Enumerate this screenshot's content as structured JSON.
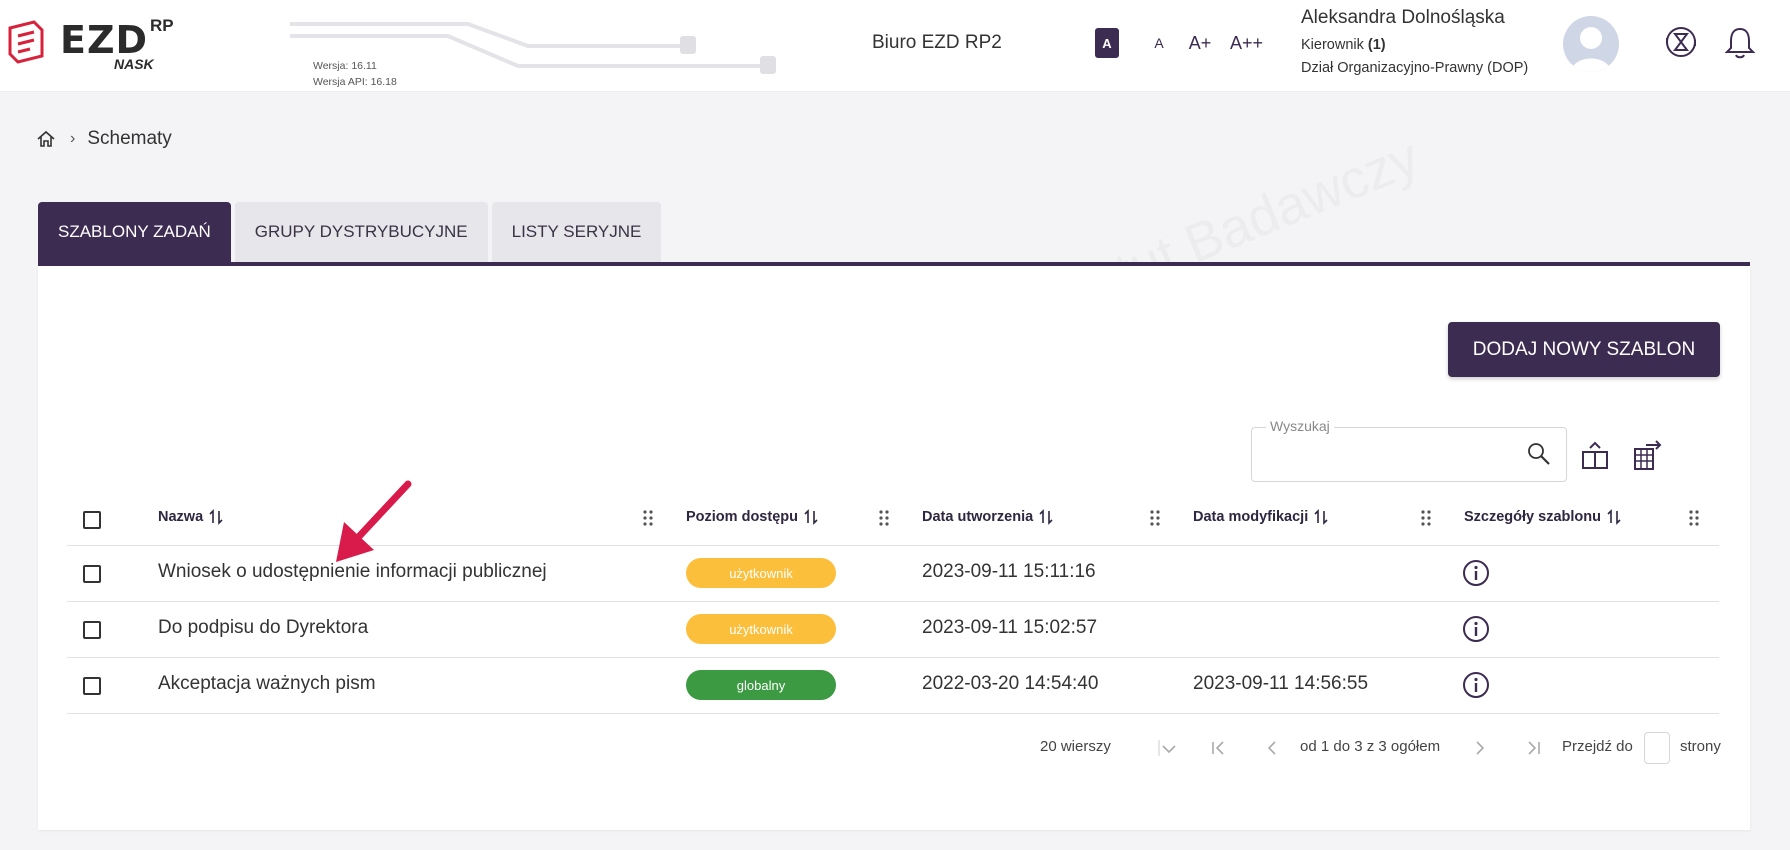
{
  "header": {
    "logo_main": "EZD",
    "logo_sup": "RP",
    "logo_sub": "NASK",
    "version": "Wersja: 16.11",
    "api_version": "Wersja API: 16.18",
    "office": "Biuro EZD RP2",
    "font_sizes": [
      "A",
      "A",
      "A+",
      "A++"
    ],
    "user": {
      "name": "Aleksandra Dolnośląska",
      "role": "Kierownik",
      "role_count": "(1)",
      "department": "Dział Organizacyjno-Prawny (DOP)"
    }
  },
  "breadcrumb": {
    "current": "Schematy"
  },
  "tabs": [
    {
      "label": "SZABLONY ZADAŃ",
      "active": true
    },
    {
      "label": "GRUPY DYSTRYBUCYJNE",
      "active": false
    },
    {
      "label": "LISTY SERYJNE",
      "active": false
    }
  ],
  "toolbar": {
    "add_label": "DODAJ NOWY SZABLON",
    "search_label": "Wyszukaj",
    "search_value": ""
  },
  "table": {
    "columns": [
      "Nazwa",
      "Poziom dostępu",
      "Data utworzenia",
      "Data modyfikacji",
      "Szczegóły szablonu"
    ],
    "rows": [
      {
        "name": "Wniosek o udostępnienie informacji publicznej",
        "access": "użytkownik",
        "created": "2023-09-11 15:11:16",
        "modified": ""
      },
      {
        "name": "Do podpisu do Dyrektora",
        "access": "użytkownik",
        "created": "2023-09-11 15:02:57",
        "modified": ""
      },
      {
        "name": "Akceptacja ważnych pism",
        "access": "globalny",
        "created": "2022-03-20 14:54:40",
        "modified": "2023-09-11 14:56:55"
      }
    ]
  },
  "pagination": {
    "rows_per_page": "20 wierszy",
    "range": "od 1 do 3 z 3 ogółem",
    "goto_label": "Przejdź do",
    "page_suffix": "strony",
    "page_value": ""
  },
  "colors": {
    "primary": "#3d2c52",
    "badge_user": "#fbbf3c",
    "badge_global": "#3c9a42",
    "annotation_arrow": "#d81b4a"
  },
  "watermark_text": "NASK – Państwowy Instytut Badawczy"
}
